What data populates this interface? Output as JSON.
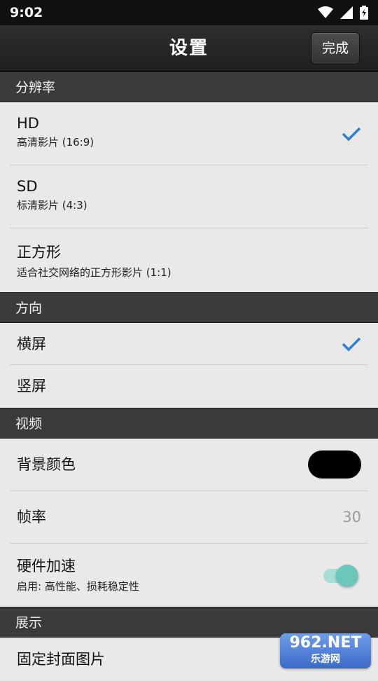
{
  "status_bar": {
    "time": "9:02",
    "icons": [
      "wifi-icon",
      "signal-icon",
      "battery-icon"
    ]
  },
  "app_bar": {
    "title": "设置",
    "done_label": "完成"
  },
  "sections": {
    "resolution": {
      "header": "分辨率",
      "items": [
        {
          "label": "HD",
          "subtitle": "高清影片 (16:9)",
          "checked": true
        },
        {
          "label": "SD",
          "subtitle": "标清影片 (4:3)",
          "checked": false
        },
        {
          "label": "正方形",
          "subtitle": "适合社交网络的正方形影片 (1:1)",
          "checked": false
        }
      ]
    },
    "orientation": {
      "header": "方向",
      "items": [
        {
          "label": "横屏",
          "checked": true
        },
        {
          "label": "竖屏",
          "checked": false
        }
      ]
    },
    "video": {
      "header": "视频",
      "background_color": {
        "label": "背景颜色",
        "color": "#000000"
      },
      "frame_rate": {
        "label": "帧率",
        "value": "30"
      },
      "hardware_accel": {
        "label": "硬件加速",
        "subtitle": "启用: 高性能、损耗稳定性",
        "enabled": true
      }
    },
    "display": {
      "header": "展示",
      "items": [
        {
          "label": "固定封面图片"
        }
      ]
    }
  },
  "watermark": {
    "line1": "962.NET",
    "line2": "乐游网"
  },
  "colors": {
    "accent_check": "#2f7fd6",
    "toggle_on": "#6ac7b9"
  }
}
